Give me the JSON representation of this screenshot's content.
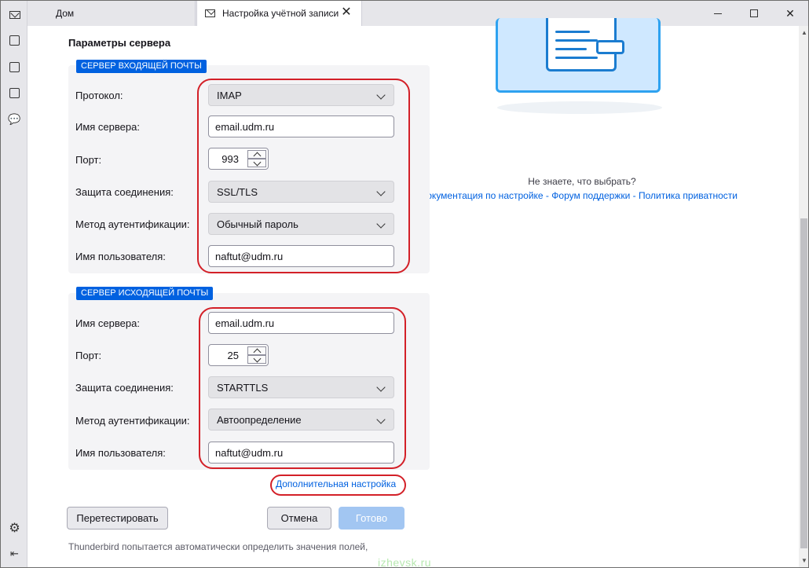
{
  "tabs": {
    "home": "Дом",
    "active": "Настройка учётной записи"
  },
  "section_title": "Параметры сервера",
  "incoming": {
    "badge": "СЕРВЕР ВХОДЯЩЕЙ ПОЧТЫ",
    "protocol_label": "Протокол:",
    "protocol_value": "IMAP",
    "server_label": "Имя сервера:",
    "server_value": "email.udm.ru",
    "port_label": "Порт:",
    "port_value": "993",
    "security_label": "Защита соединения:",
    "security_value": "SSL/TLS",
    "auth_label": "Метод аутентификации:",
    "auth_value": "Обычный пароль",
    "user_label": "Имя пользователя:",
    "user_value": "naftut@udm.ru"
  },
  "outgoing": {
    "badge": "СЕРВЕР ИСХОДЯЩЕЙ ПОЧТЫ",
    "server_label": "Имя сервера:",
    "server_value": "email.udm.ru",
    "port_label": "Порт:",
    "port_value": "25",
    "security_label": "Защита соединения:",
    "security_value": "STARTTLS",
    "auth_label": "Метод аутентификации:",
    "auth_value": "Автоопределение",
    "user_label": "Имя пользователя:",
    "user_value": "naftut@udm.ru"
  },
  "advanced_link": "Дополнительная настройка",
  "buttons": {
    "retest": "Перетестировать",
    "cancel": "Отмена",
    "done": "Готово"
  },
  "footnote": "Thunderbird попытается автоматически определить значения полей,",
  "help": {
    "question": "Не знаете, что выбрать?",
    "docs": "Документация по настройке",
    "forum": "Форум поддержки",
    "privacy": "Политика приватности",
    "separator": " - "
  },
  "watermark": "izhevsk.ru",
  "colors": {
    "accent": "#0061e0",
    "highlight": "#d32028",
    "done_disabled": "#a2c6f2"
  }
}
